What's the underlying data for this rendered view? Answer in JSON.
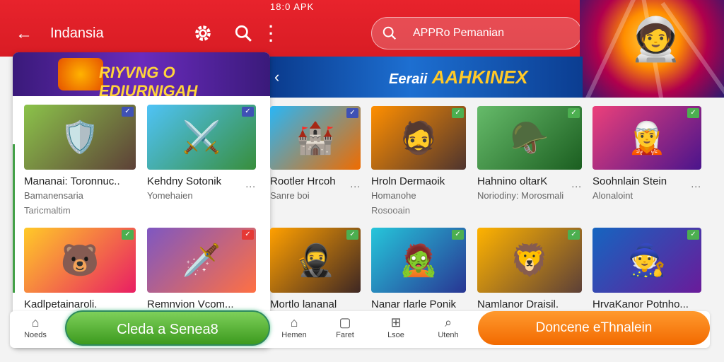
{
  "status": {
    "time": "18:0 APK"
  },
  "header": {
    "title": "Indansia"
  },
  "search": {
    "placeholder": "APPRo Pemanian"
  },
  "banner": {
    "word1": "Eeraii",
    "word2": "AAHKINEX"
  },
  "panel": {
    "banner_title": "RIYVNG O EDIURNIGAH",
    "cards": [
      {
        "name": "Mananai: Toronnuc..",
        "sub": "Bamanensaria",
        "sub2": "Taricmaltim",
        "dots": "...",
        "check_color": "#3f51b5"
      },
      {
        "name": "Kehdny Sotonik",
        "sub": "Yomehaien",
        "dots": "...",
        "check_color": "#3f51b5"
      },
      {
        "name": "Kadlpetainaroli.",
        "dots": "",
        "check_color": "#4caf50"
      },
      {
        "name": "Remnvion Vcom...",
        "dots": "",
        "check_color": "#e53935"
      }
    ]
  },
  "grid": [
    {
      "name": "Rootler Hrcoh",
      "sub": "Sanre boi",
      "dots": "...",
      "check_color": "#3f51b5"
    },
    {
      "name": "Hroln Dermaoik",
      "sub": "Homanohe",
      "sub2": "Rosooain",
      "dots": "",
      "check_color": "#4caf50"
    },
    {
      "name": "Hahnino oltarK",
      "sub": "Noriodiny: Morosmali",
      "dots": "...",
      "check_color": "#4caf50"
    },
    {
      "name": "Soohnlain Stein",
      "sub": "Alonaloint",
      "dots": "...",
      "check_color": "#4caf50"
    },
    {
      "name": "Mortlo lananal",
      "dots": "",
      "check_color": "#4caf50"
    },
    {
      "name": "Nanar rlarle Ponik",
      "dots": "",
      "check_color": "#4caf50"
    },
    {
      "name": "Namlanor Draisil.",
      "dots": "",
      "check_color": "#4caf50"
    },
    {
      "name": "HrvaKanor Potnho...",
      "dots": "",
      "check_color": "#4caf50"
    }
  ],
  "bottom_nav": [
    {
      "label": "Noeds"
    },
    {
      "label": "Hemen"
    },
    {
      "label": "Faret"
    },
    {
      "label": "Lsoe"
    },
    {
      "label": "Utenh"
    }
  ],
  "buttons": {
    "green": "Cleda a Senea8",
    "orange": "Doncene eThnalein"
  },
  "colors": {
    "brand": "#e8232c",
    "accent_green": "#4caf50",
    "accent_orange": "#f26a00"
  }
}
